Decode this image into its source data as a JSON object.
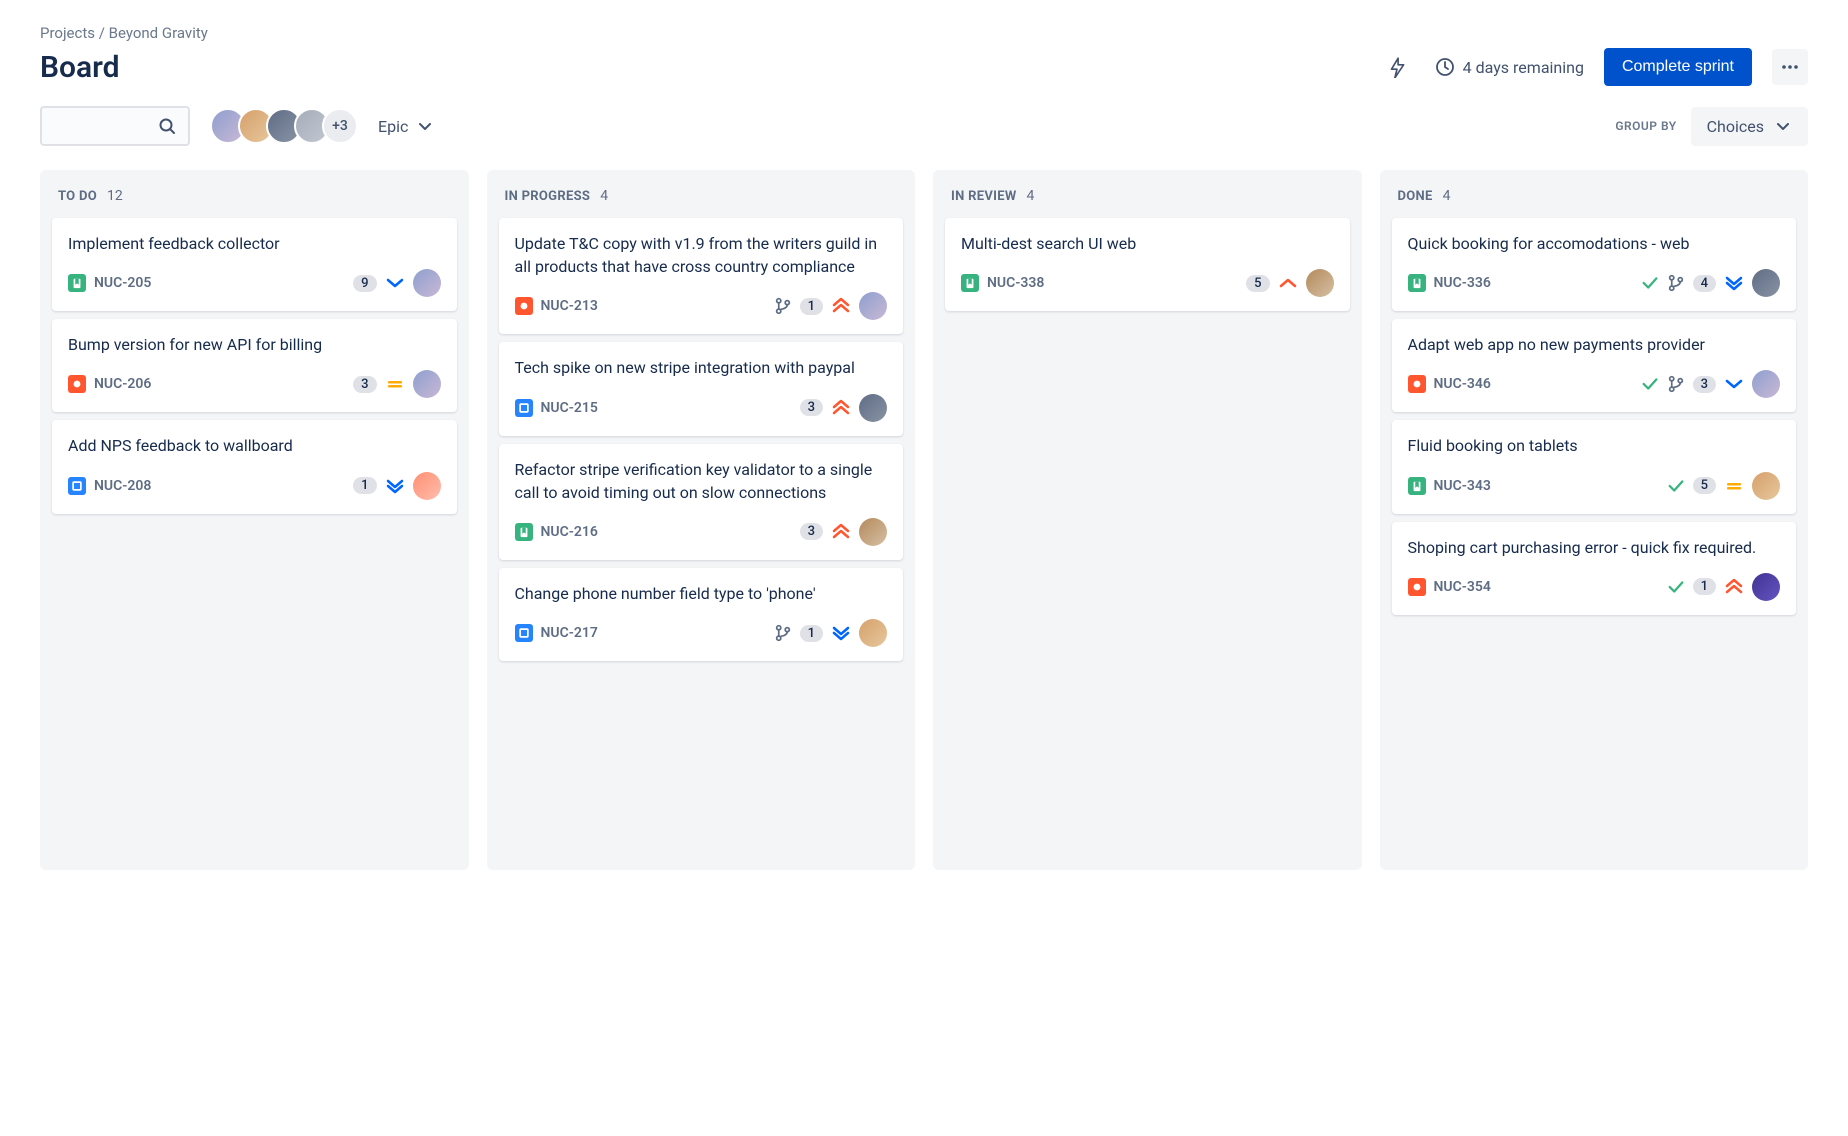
{
  "breadcrumb": {
    "root": "Projects",
    "project": "Beyond Gravity"
  },
  "page": {
    "title": "Board"
  },
  "header": {
    "remaining": "4 days remaining",
    "complete_label": "Complete sprint"
  },
  "toolbar": {
    "epic_label": "Epic",
    "group_by_label": "GROUP BY",
    "choices_label": "Choices",
    "avatar_more": "+3"
  },
  "columns": [
    {
      "title": "TO DO",
      "count": "12"
    },
    {
      "title": "IN PROGRESS",
      "count": "4"
    },
    {
      "title": "IN REVIEW",
      "count": "4"
    },
    {
      "title": "DONE",
      "count": "4"
    }
  ],
  "cards": {
    "todo": [
      {
        "title": "Implement feedback collector",
        "key": "NUC-205",
        "type": "story",
        "count": "9",
        "priority": "low",
        "assignee": "av1"
      },
      {
        "title": "Bump version for new API for billing",
        "key": "NUC-206",
        "type": "bug",
        "count": "3",
        "priority": "medium",
        "assignee": "av1"
      },
      {
        "title": "Add NPS feedback to wallboard",
        "key": "NUC-208",
        "type": "task",
        "count": "1",
        "priority": "lowest",
        "assignee": "av5"
      }
    ],
    "inprogress": [
      {
        "title": "Update T&C copy with v1.9 from the writers guild in all products that have cross country compliance",
        "key": "NUC-213",
        "type": "bug",
        "branch": true,
        "count": "1",
        "priority": "highest",
        "assignee": "av1"
      },
      {
        "title": "Tech spike on new stripe integration with paypal",
        "key": "NUC-215",
        "type": "task",
        "count": "3",
        "priority": "highest",
        "assignee": "av3"
      },
      {
        "title": "Refactor stripe verification key validator to a single call to avoid timing out on slow connections",
        "key": "NUC-216",
        "type": "story",
        "count": "3",
        "priority": "highest",
        "assignee": "av6"
      },
      {
        "title": "Change phone number field type to 'phone'",
        "key": "NUC-217",
        "type": "task",
        "branch": true,
        "count": "1",
        "priority": "lowest",
        "assignee": "av2"
      }
    ],
    "inreview": [
      {
        "title": "Multi-dest search UI web",
        "key": "NUC-338",
        "type": "story",
        "count": "5",
        "priority": "mediumhigh",
        "assignee": "av6"
      }
    ],
    "done": [
      {
        "title": "Quick booking for accomodations - web",
        "key": "NUC-336",
        "type": "story",
        "check": true,
        "branch": true,
        "count": "4",
        "priority": "lowest",
        "assignee": "av3"
      },
      {
        "title": "Adapt web app no new payments provider",
        "key": "NUC-346",
        "type": "bug",
        "check": true,
        "branch": true,
        "count": "3",
        "priority": "low",
        "assignee": "av1"
      },
      {
        "title": "Fluid booking on tablets",
        "key": "NUC-343",
        "type": "story",
        "check": true,
        "count": "5",
        "priority": "medium",
        "assignee": "av2"
      },
      {
        "title": "Shoping cart purchasing error - quick fix required.",
        "key": "NUC-354",
        "type": "bug",
        "check": true,
        "count": "1",
        "priority": "highest",
        "assignee": "av7"
      }
    ]
  }
}
